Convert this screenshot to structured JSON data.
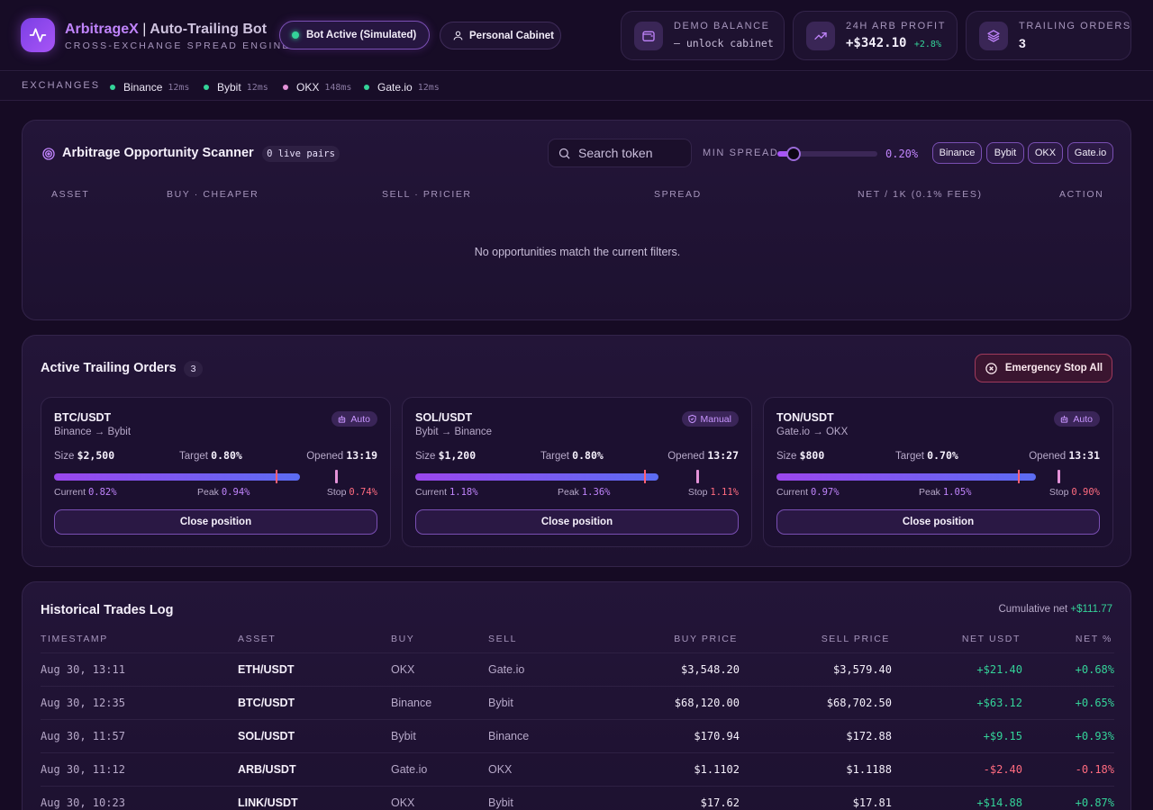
{
  "header": {
    "brand_accent": "ArbitrageX",
    "brand_sep": "|",
    "brand_rest": "Auto-Trailing Bot",
    "subtitle": "CROSS-EXCHANGE SPREAD ENGINE",
    "bot_status": "Bot Active (Simulated)",
    "cabinet_label": "Personal Cabinet",
    "stats": [
      {
        "label": "DEMO BALANCE",
        "value": "— unlock cabinet",
        "icon": "wallet-icon"
      },
      {
        "label": "24H ARB PROFIT",
        "value": "+$342.10",
        "delta": "+2.8%",
        "icon": "trending-up-icon"
      },
      {
        "label": "TRAILING ORDERS",
        "value": "3",
        "icon": "layers-icon"
      }
    ]
  },
  "exchanges": {
    "title": "EXCHANGES",
    "items": [
      {
        "name": "Binance",
        "latency": "12ms",
        "color": "#34d399"
      },
      {
        "name": "Bybit",
        "latency": "12ms",
        "color": "#34d399"
      },
      {
        "name": "OKX",
        "latency": "148ms",
        "color": "#e492d8"
      },
      {
        "name": "Gate.io",
        "latency": "12ms",
        "color": "#34d399"
      }
    ]
  },
  "scanner": {
    "title": "Arbitrage Opportunity Scanner",
    "live_pairs": "0 live pairs",
    "search_placeholder": "Search token",
    "min_spread_label": "MIN SPREAD",
    "min_spread_value": "0.20%",
    "min_spread_fraction": 0.16,
    "filters": [
      "Binance",
      "Bybit",
      "OKX",
      "Gate.io"
    ],
    "columns": [
      "ASSET",
      "BUY · CHEAPER",
      "SELL · PRICIER",
      "SPREAD",
      "NET / 1K (0.1% FEES)",
      "ACTION"
    ],
    "empty_message": "No opportunities match the current filters."
  },
  "trailing": {
    "title": "Active Trailing Orders",
    "count": "3",
    "emergency_label": "Emergency Stop All",
    "size_label": "Size",
    "target_label": "Target",
    "opened_label": "Opened",
    "current_label": "Current",
    "peak_label": "Peak",
    "stop_label": "Stop",
    "close_label": "Close position",
    "orders": [
      {
        "pair": "BTC/USDT",
        "route": "Binance → Bybit",
        "mode": "Auto",
        "size": "$2,500",
        "target": "0.80%",
        "opened": "13:19",
        "current": "0.82%",
        "peak": "0.94%",
        "stop": "0.74%"
      },
      {
        "pair": "SOL/USDT",
        "route": "Bybit → Binance",
        "mode": "Manual",
        "size": "$1,200",
        "target": "0.80%",
        "opened": "13:27",
        "current": "1.18%",
        "peak": "1.36%",
        "stop": "1.11%"
      },
      {
        "pair": "TON/USDT",
        "route": "Gate.io → OKX",
        "mode": "Auto",
        "size": "$800",
        "target": "0.70%",
        "opened": "13:31",
        "current": "0.97%",
        "peak": "1.05%",
        "stop": "0.90%"
      }
    ]
  },
  "history": {
    "title": "Historical Trades Log",
    "cumulative_label": "Cumulative net",
    "cumulative_value": "+$111.77",
    "columns": [
      "TIMESTAMP",
      "ASSET",
      "BUY",
      "SELL",
      "BUY PRICE",
      "SELL PRICE",
      "NET USDT",
      "NET %"
    ],
    "rows": [
      {
        "ts": "Aug 30, 13:11",
        "asset": "ETH/USDT",
        "buy": "OKX",
        "sell": "Gate.io",
        "buy_price": "$3,548.20",
        "sell_price": "$3,579.40",
        "net": "+$21.40",
        "pct": "+0.68%",
        "positive": true
      },
      {
        "ts": "Aug 30, 12:35",
        "asset": "BTC/USDT",
        "buy": "Binance",
        "sell": "Bybit",
        "buy_price": "$68,120.00",
        "sell_price": "$68,702.50",
        "net": "+$63.12",
        "pct": "+0.65%",
        "positive": true
      },
      {
        "ts": "Aug 30, 11:57",
        "asset": "SOL/USDT",
        "buy": "Bybit",
        "sell": "Binance",
        "buy_price": "$170.94",
        "sell_price": "$172.88",
        "net": "+$9.15",
        "pct": "+0.93%",
        "positive": true
      },
      {
        "ts": "Aug 30, 11:12",
        "asset": "ARB/USDT",
        "buy": "Gate.io",
        "sell": "OKX",
        "buy_price": "$1.1102",
        "sell_price": "$1.1188",
        "net": "-$2.40",
        "pct": "-0.18%",
        "positive": false
      },
      {
        "ts": "Aug 30, 10:23",
        "asset": "LINK/USDT",
        "buy": "OKX",
        "sell": "Bybit",
        "buy_price": "$17.62",
        "sell_price": "$17.81",
        "net": "+$14.88",
        "pct": "+0.87%",
        "positive": true
      }
    ]
  }
}
